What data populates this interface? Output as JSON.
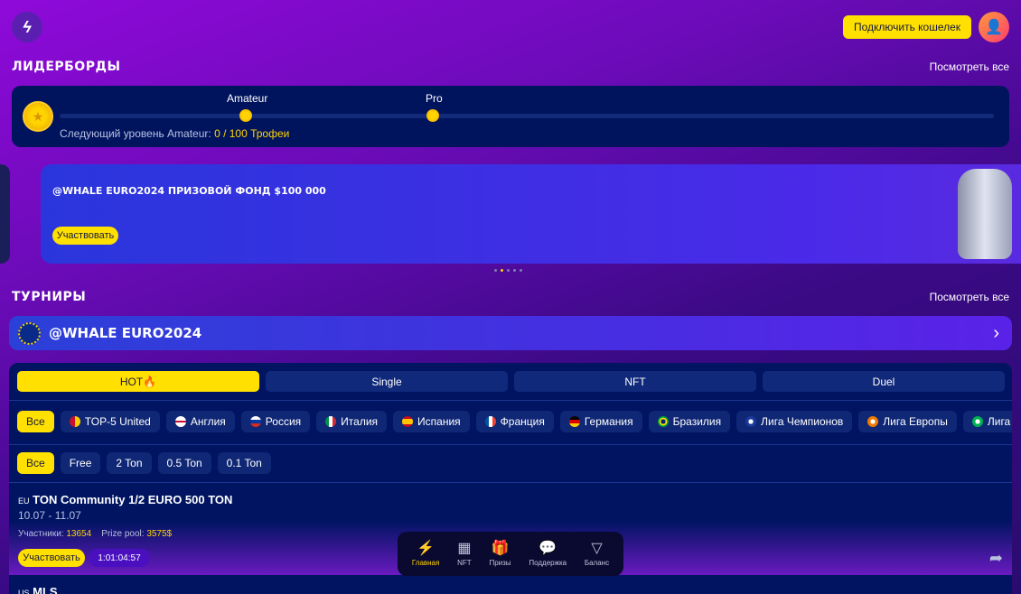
{
  "header": {
    "connect_wallet": "Подключить кошелек",
    "logo_icon": "lightning-logo",
    "avatar_icon": "add-user-icon"
  },
  "leaderboards": {
    "title": "ЛИДЕРБОРДЫ",
    "see_all": "Посмотреть все",
    "levels": [
      "Amateur",
      "Pro"
    ],
    "next_label": "Следующий уровень Amateur:",
    "progress_text": "0 / 100 Трофеи",
    "progress_value": 0,
    "progress_max": 100
  },
  "banner": {
    "title": "@WHALE EURO2024 ПРИЗОВОЙ ФОНД $100 000",
    "button": "Участвовать",
    "slides": 5,
    "active_slide": 2
  },
  "tournaments": {
    "title": "ТУРНИРЫ",
    "see_all": "Посмотреть все",
    "featured": "@WHALE EURO2024",
    "tabs": [
      "HOT🔥",
      "Single",
      "NFT",
      "Duel"
    ],
    "active_tab": 0,
    "leagues": [
      {
        "label": "Все"
      },
      {
        "label": "TOP-5 United",
        "flag": "linear-gradient(90deg,#c8102e 50%,#ffce00 50%)"
      },
      {
        "label": "Англия",
        "flag": "linear-gradient(#fff 40%,#c8102e 40%,#c8102e 60%,#fff 60%)"
      },
      {
        "label": "Россия",
        "flag": "linear-gradient(#fff 33%,#0039a6 33%,#0039a6 66%,#d52b1e 66%)"
      },
      {
        "label": "Италия",
        "flag": "linear-gradient(90deg,#009246 33%,#fff 33%,#fff 66%,#ce2b37 66%)"
      },
      {
        "label": "Испания",
        "flag": "linear-gradient(#c60b1e 25%,#ffc400 25%,#ffc400 75%,#c60b1e 75%)"
      },
      {
        "label": "Франция",
        "flag": "linear-gradient(90deg,#0055a4 33%,#fff 33%,#fff 66%,#ef4135 66%)"
      },
      {
        "label": "Германия",
        "flag": "linear-gradient(#000 33%,#dd0000 33%,#dd0000 66%,#ffce00 66%)"
      },
      {
        "label": "Бразилия",
        "flag": "radial-gradient(circle,#002776 30%,#ffdf00 32%,#ffdf00 50%,#009c3b 52%)"
      },
      {
        "label": "Лига Чемпионов",
        "flag": "radial-gradient(circle,#fff 30%,#1a3a9a 32%)"
      },
      {
        "label": "Лига Европы",
        "flag": "radial-gradient(circle,#fff 30%,#f07a00 32%)"
      },
      {
        "label": "Лига Конференций",
        "flag": "radial-gradient(circle,#fff 30%,#00b050 32%)"
      }
    ],
    "active_league": 0,
    "stakes": [
      "Все",
      "Free",
      "2 Ton",
      "0.5 Ton",
      "0.1 Ton"
    ],
    "active_stake": 0,
    "items": [
      {
        "region": "EU",
        "name": "TON Community 1/2 EURO 500 TON",
        "dates": "10.07 - 11.07",
        "participants_label": "Участники:",
        "participants": "13654",
        "prize_label": "Prize pool:",
        "prize": "3575$",
        "button": "Участвовать",
        "timer": "1:01:04:57"
      },
      {
        "region": "US",
        "name": "MLS"
      }
    ]
  },
  "nav": [
    {
      "label": "Главная",
      "icon": "⚡"
    },
    {
      "label": "NFT",
      "icon": "▦"
    },
    {
      "label": "Призы",
      "icon": "🎁"
    },
    {
      "label": "Поддержка",
      "icon": "💬"
    },
    {
      "label": "Баланс",
      "icon": "▽"
    }
  ],
  "colors": {
    "accent": "#ffe000",
    "panel": "#001462"
  }
}
